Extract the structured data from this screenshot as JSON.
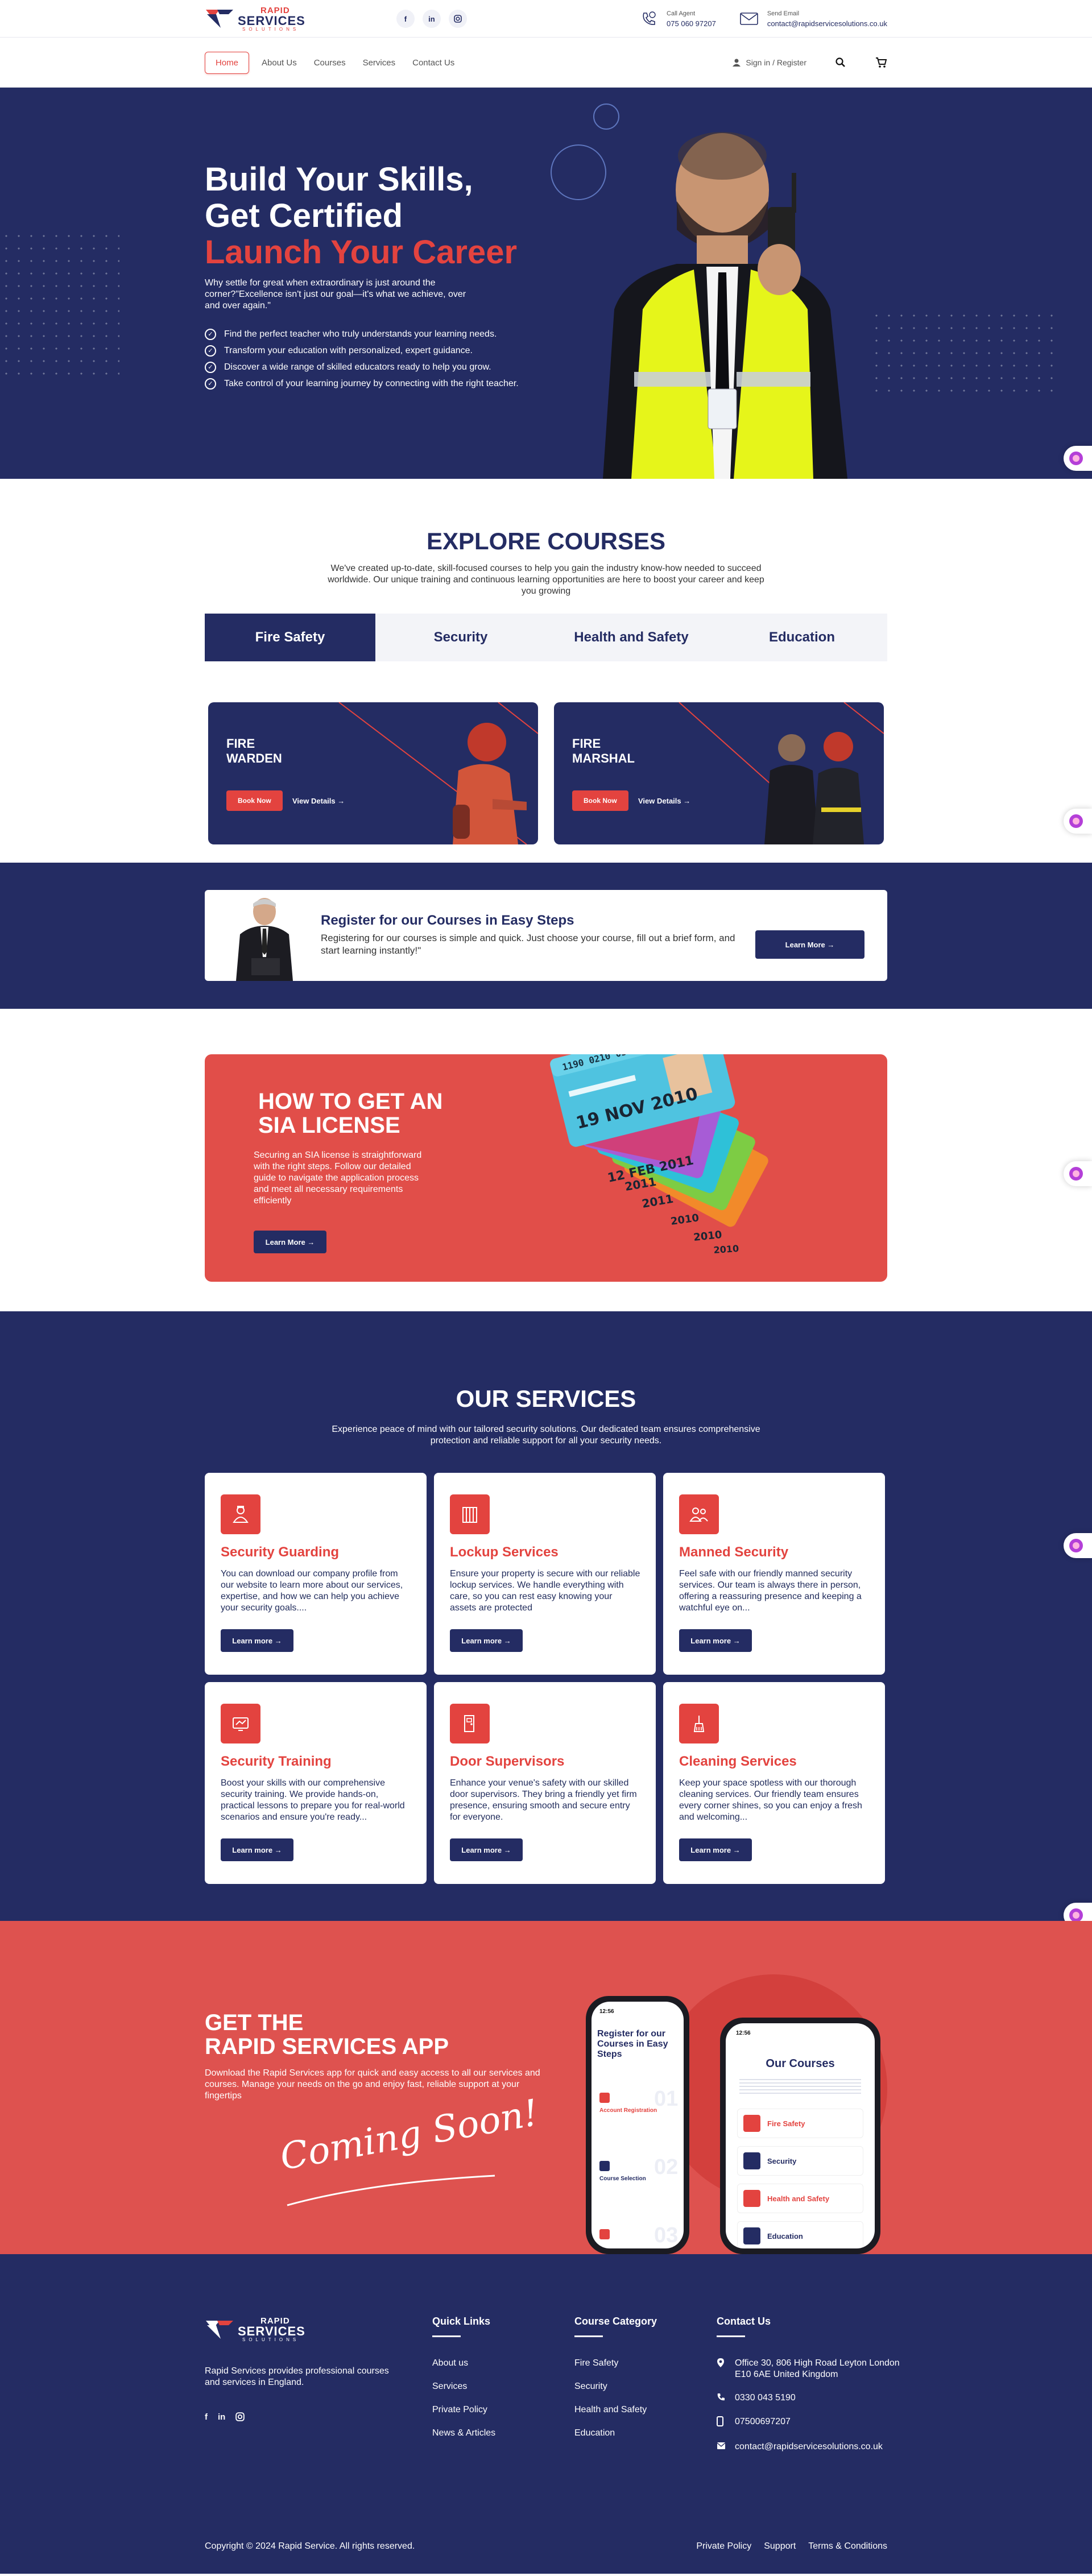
{
  "topbar": {
    "logo": {
      "line1": "RAPID",
      "line2": "SERVICES",
      "line3": "SOLUTIONS"
    },
    "socials": [
      "facebook-icon",
      "linkedin-icon",
      "instagram-icon"
    ],
    "call": {
      "label": "Call Agent",
      "value": "075 060 97207"
    },
    "email": {
      "label": "Send Email",
      "value": "contact@rapidservicesolutions.co.uk"
    }
  },
  "nav": {
    "items": [
      "Home",
      "About Us",
      "Courses",
      "Services",
      "Contact Us"
    ],
    "signin": "Sign in / Register"
  },
  "hero": {
    "line1": "Build Your Skills,",
    "line2": "Get Certified",
    "line3": "Launch Your Career",
    "intro": "Why settle for great when extraordinary is just around the corner?\"Excellence isn't just our goal—it's what we achieve, over and over again.\"",
    "bullets": [
      "Find the perfect teacher who truly understands your learning needs.",
      "Transform your education with personalized, expert guidance.",
      "Discover a wide range of skilled educators ready to help you grow.",
      "Take control of your learning journey by connecting with the right teacher."
    ]
  },
  "explore": {
    "title": "EXPLORE COURSES",
    "subtitle": "We've created up-to-date, skill-focused courses to help you gain the industry know-how needed to succeed worldwide. Our unique training and continuous learning opportunities are here to boost your career and keep you growing",
    "tabs": [
      "Fire Safety",
      "Security",
      "Health and Safety",
      "Education"
    ],
    "cards": [
      {
        "line1": "FIRE",
        "line2": "WARDEN",
        "book": "Book Now",
        "details": "View Details →"
      },
      {
        "line1": "FIRE",
        "line2": "MARSHAL",
        "book": "Book Now",
        "details": "View Details →"
      }
    ]
  },
  "register": {
    "title": "Register for our Courses in Easy Steps",
    "text": "Registering for our courses is simple and quick. Just choose your course, fill out a brief form, and start learning instantly!\"",
    "button": "Learn More →"
  },
  "sia": {
    "title1": "HOW TO GET AN",
    "title2": "SIA LICENSE",
    "text": "Securing an SIA license is straightforward with the right steps. Follow our detailed guide to navigate the application process and meet all necessary requirements efficiently",
    "button": "Learn More →",
    "cards": [
      "19 NOV 2010",
      "12 FEB 2011",
      "2011",
      "2010",
      "2011",
      "2010",
      "2010"
    ]
  },
  "services": {
    "title": "OUR SERVICES",
    "subtitle": "Experience peace of mind with our tailored security solutions. Our dedicated team ensures comprehensive protection and reliable support for all your security needs.",
    "button": "Learn more →",
    "items": [
      {
        "title": "Security Guarding",
        "text": "You can download our company profile from our website to learn more about our services, expertise, and how we can help you achieve your security goals....",
        "icon": "guard-icon"
      },
      {
        "title": "Lockup Services",
        "text": "Ensure your property is secure with our reliable lockup services. We handle everything with care, so you can rest easy knowing your assets are protected",
        "icon": "lock-icon"
      },
      {
        "title": "Manned Security",
        "text": "Feel safe with our friendly manned security services. Our team is always there in person, offering a reassuring presence and keeping a watchful eye on...",
        "icon": "team-icon"
      },
      {
        "title": "Security Training",
        "text": "Boost your skills with our comprehensive security training. We provide hands-on, practical lessons to prepare you for real-world scenarios and ensure you're ready...",
        "icon": "training-icon"
      },
      {
        "title": "Door Supervisors",
        "text": "Enhance your venue's safety with our skilled door supervisors. They bring a friendly yet firm presence, ensuring smooth and secure entry for everyone.",
        "icon": "door-icon"
      },
      {
        "title": "Cleaning Services",
        "text": "Keep your space spotless with our thorough cleaning services. Our friendly team ensures every corner shines, so you can enjoy a fresh and welcoming...",
        "icon": "cleaning-icon"
      }
    ]
  },
  "app": {
    "title1": "GET THE",
    "title2": "RAPID SERVICES APP",
    "text": "Download the Rapid Services app for quick and easy access to all our services and courses. Manage your needs on the go and enjoy fast, reliable support at your fingertips",
    "soon": "Coming Soon!",
    "phone1": {
      "time": "12:56",
      "title": "Register for our Courses in Easy Steps",
      "steps": [
        "Account Registration",
        "Course Selection"
      ],
      "numbers": [
        "01",
        "02",
        "03"
      ]
    },
    "phone2": {
      "time": "12:56",
      "title": "Our Courses",
      "items": [
        "Fire Safety",
        "Security",
        "Health and Safety",
        "Education"
      ]
    }
  },
  "footer": {
    "about": "Rapid Services provides professional courses and services in England.",
    "quick": {
      "title": "Quick Links",
      "items": [
        "About us",
        "Services",
        "Private Policy",
        "News & Articles"
      ]
    },
    "category": {
      "title": "Course Category",
      "items": [
        "Fire Safety",
        "Security",
        "Health and Safety",
        "Education"
      ]
    },
    "contact": {
      "title": "Contact Us",
      "address": "Office 30, 806 High Road Leyton London E10 6AE United Kingdom",
      "phone": "0330 043 5190",
      "mobile": "07500697207",
      "email": "contact@rapidservicesolutions.co.uk"
    },
    "copyright": "Copyright © 2024 Rapid Service. All rights reserved.",
    "bottom_links": [
      "Private Policy",
      "Support",
      "Terms & Conditions"
    ]
  },
  "colors": {
    "navy": "#242c63",
    "red": "#e3433f",
    "coral": "#de524f"
  }
}
